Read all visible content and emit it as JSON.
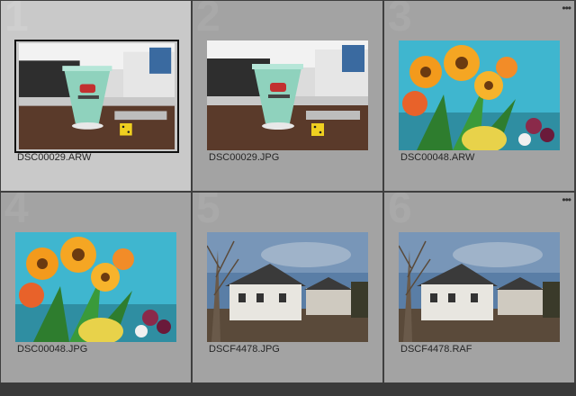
{
  "grid": {
    "cells": [
      {
        "index": "1",
        "filename": "DSC00029.ARW",
        "selected": true,
        "menu": "",
        "image": "mug-icon"
      },
      {
        "index": "2",
        "filename": "DSC00029.JPG",
        "selected": false,
        "menu": "",
        "image": "mug-icon"
      },
      {
        "index": "3",
        "filename": "DSC00048.ARW",
        "selected": false,
        "menu": "•••",
        "image": "flowers-icon"
      },
      {
        "index": "4",
        "filename": "DSC00048.JPG",
        "selected": false,
        "menu": "",
        "image": "flowers-icon"
      },
      {
        "index": "5",
        "filename": "DSCF4478.JPG",
        "selected": false,
        "menu": "",
        "image": "house-icon"
      },
      {
        "index": "6",
        "filename": "DSCF4478.RAF",
        "selected": false,
        "menu": "•••",
        "image": "house-icon"
      }
    ]
  }
}
